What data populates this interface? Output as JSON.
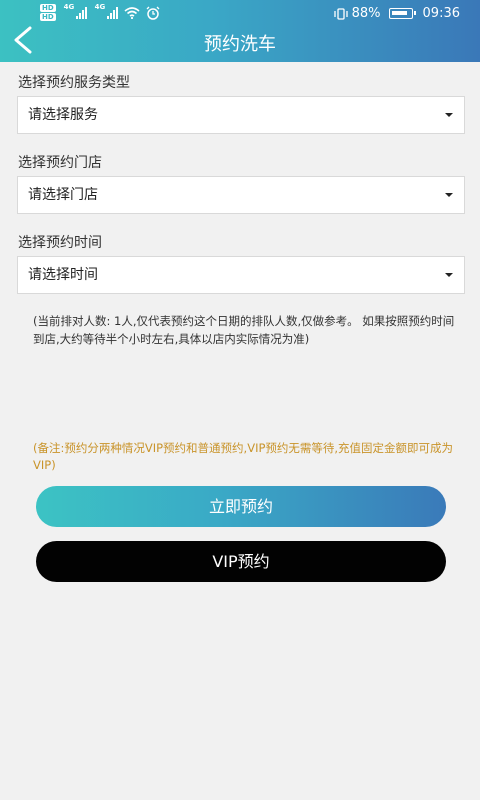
{
  "status_bar": {
    "hd_badges": [
      "HD",
      "HD"
    ],
    "network_labels": [
      "4G",
      "4G"
    ],
    "battery_percent": "88%",
    "time": "09:36"
  },
  "header": {
    "title": "预约洗车"
  },
  "form": {
    "service": {
      "label": "选择预约服务类型",
      "value": "请选择服务"
    },
    "store": {
      "label": "选择预约门店",
      "value": "请选择门店"
    },
    "time": {
      "label": "选择预约时间",
      "value": "请选择时间"
    }
  },
  "queue_note": "(当前排对人数: 1人,仅代表预约这个日期的排队人数,仅做参考。 如果按照预约时间到店,大约等待半个小时左右,具体以店内实际情况为准)",
  "remark": "(备注:预约分两种情况VIP预约和普通预约,VIP预约无需等待,充值固定金额即可成为VIP)",
  "buttons": {
    "book_now": "立即预约",
    "vip_book": "VIP预约"
  },
  "colors": {
    "header_gradient_start": "#3cc1c2",
    "header_gradient_end": "#3a78b8",
    "remark_text": "#c9942a",
    "vip_button": "#020202"
  }
}
